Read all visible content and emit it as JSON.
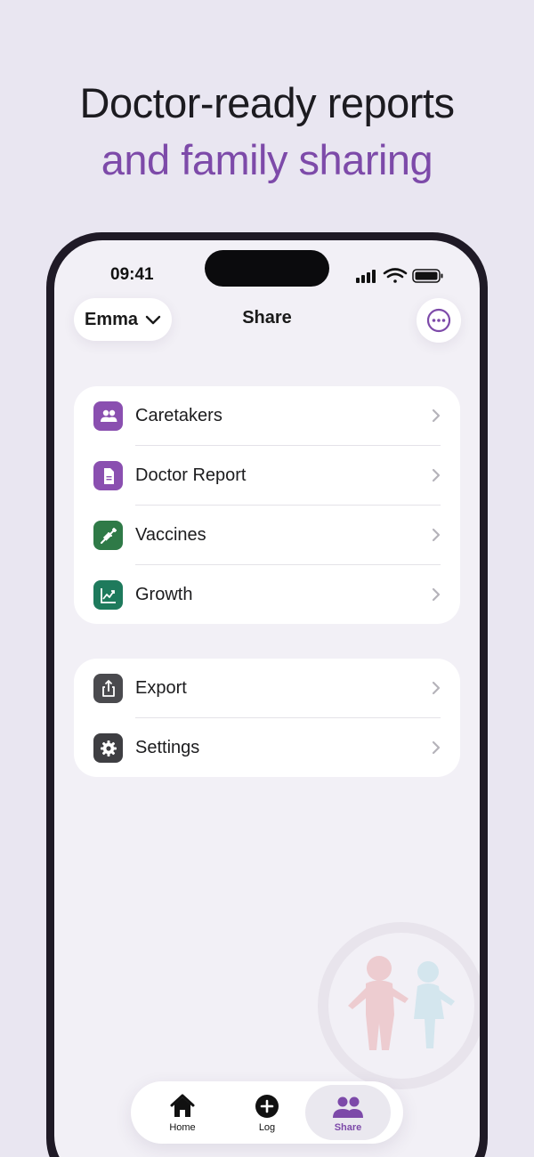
{
  "headline": {
    "line1": "Doctor-ready reports",
    "line2": "and family sharing"
  },
  "status_bar": {
    "time": "09:41"
  },
  "nav": {
    "profile_name": "Emma",
    "title": "Share",
    "more_icon": "ellipsis-circle-icon"
  },
  "sections": [
    {
      "items": [
        {
          "label": "Caretakers",
          "icon": "people-icon",
          "color": "#8a4fb0"
        },
        {
          "label": "Doctor Report",
          "icon": "document-icon",
          "color": "#8a4fb0"
        },
        {
          "label": "Vaccines",
          "icon": "syringe-icon",
          "color": "#2f7a47"
        },
        {
          "label": "Growth",
          "icon": "chart-icon",
          "color": "#1e7a5c"
        }
      ]
    },
    {
      "items": [
        {
          "label": "Export",
          "icon": "share-icon",
          "color": "#4a4a4e"
        },
        {
          "label": "Settings",
          "icon": "gear-icon",
          "color": "#3e3e42"
        }
      ]
    }
  ],
  "tabbar": {
    "tabs": [
      {
        "label": "Home",
        "icon": "house-icon",
        "active": false
      },
      {
        "label": "Log",
        "icon": "plus-circle-icon",
        "active": false
      },
      {
        "label": "Share",
        "icon": "people-icon",
        "active": true
      }
    ]
  },
  "colors": {
    "accent": "#7d4aa9",
    "background": "#e9e6f1",
    "screen": "#f2f0f6"
  }
}
